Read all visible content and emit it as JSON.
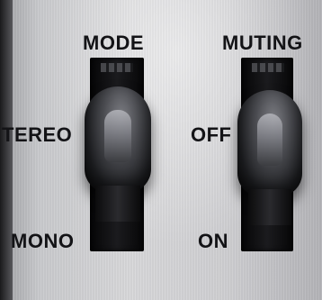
{
  "panel": {
    "mode_switch": {
      "title": "MODE",
      "upper_position": "TEREO",
      "lower_position": "MONO"
    },
    "muting_switch": {
      "title": "MUTING",
      "upper_position": "OFF",
      "lower_position": "ON"
    }
  },
  "colors": {
    "panel": "#cfcfd2",
    "lever": "#1e1f22",
    "text": "#131316"
  }
}
